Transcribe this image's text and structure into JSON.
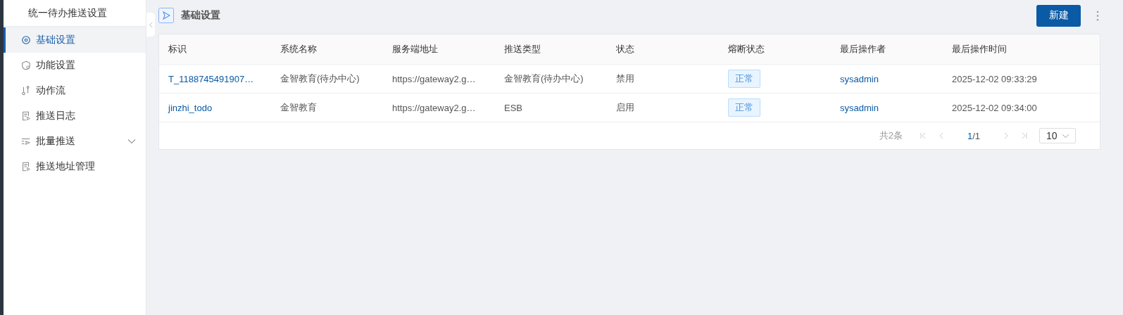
{
  "sidebar": {
    "title": "统一待办推送设置",
    "items": [
      {
        "label": "基础设置",
        "kind": "gear",
        "selected": true
      },
      {
        "label": "功能设置",
        "kind": "shield",
        "selected": false
      },
      {
        "label": "动作流",
        "kind": "flow",
        "selected": false
      },
      {
        "label": "推送日志",
        "kind": "doc",
        "selected": false
      },
      {
        "label": "批量推送",
        "kind": "send",
        "selected": false,
        "expanded": false
      },
      {
        "label": "推送地址管理",
        "kind": "doc",
        "selected": false
      }
    ]
  },
  "header": {
    "title": "基础设置",
    "new_button": "新建"
  },
  "table": {
    "columns": [
      "标识",
      "系统名称",
      "服务端地址",
      "推送类型",
      "状态",
      "熔断状态",
      "最后操作者",
      "最后操作时间"
    ],
    "rows": [
      {
        "id": "T_1188745491907…",
        "system": "金智教育(待办中心)",
        "url": "https://gateway2.g…",
        "type": "金智教育(待办中心)",
        "status": "禁用",
        "fuse": "正常",
        "operator": "sysadmin",
        "time": "2025-12-02 09:33:29"
      },
      {
        "id": "jinzhi_todo",
        "system": "金智教育",
        "url": "https://gateway2.g…",
        "type": "ESB",
        "status": "启用",
        "fuse": "正常",
        "operator": "sysadmin",
        "time": "2025-12-02 09:34:00"
      }
    ]
  },
  "pagination": {
    "total": "共2条",
    "current": "1",
    "of_pages": "/1",
    "page_size": "10"
  }
}
